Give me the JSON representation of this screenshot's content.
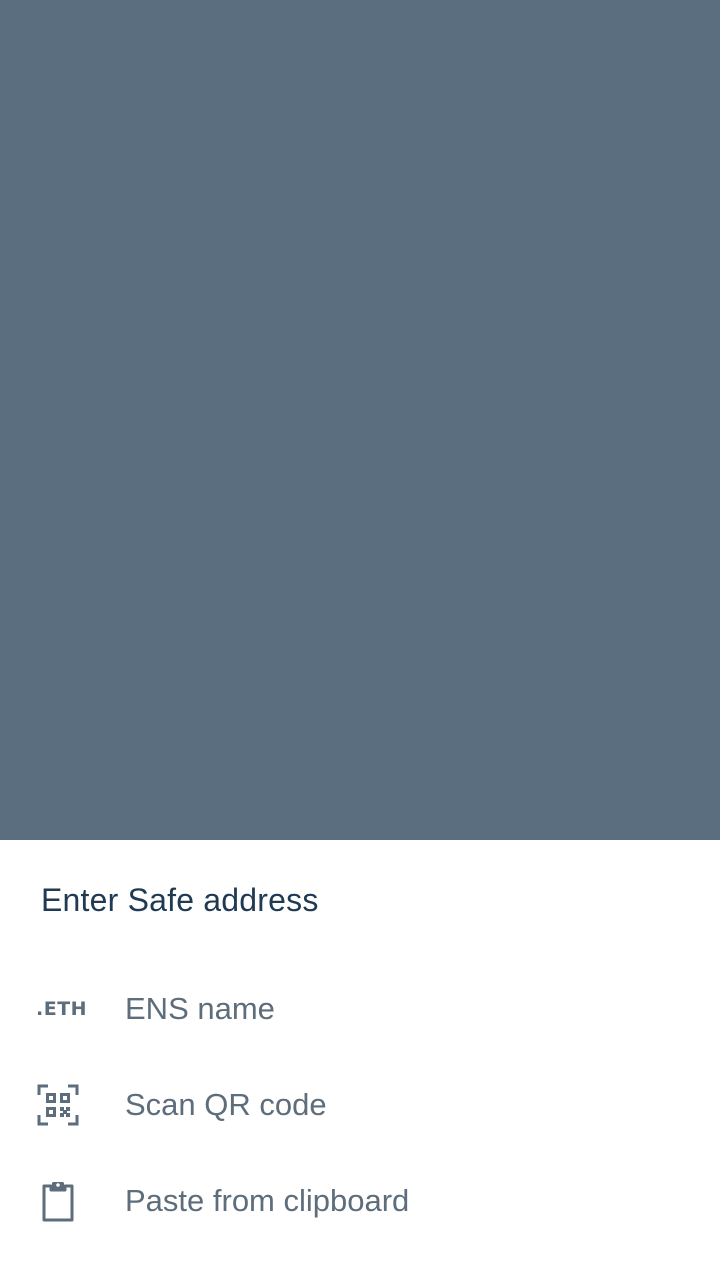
{
  "sheet": {
    "title": "Enter Safe address",
    "options": [
      {
        "label": "ENS name",
        "icon": "eth-icon",
        "icon_text": ".ETH"
      },
      {
        "label": "Scan QR code",
        "icon": "qr-code-icon"
      },
      {
        "label": "Paste from clipboard",
        "icon": "clipboard-icon"
      }
    ]
  },
  "colors": {
    "scrim": "#5a6e80",
    "sheet_background": "#ffffff",
    "title": "#1f3a52",
    "option_text": "#5d6d7b"
  }
}
